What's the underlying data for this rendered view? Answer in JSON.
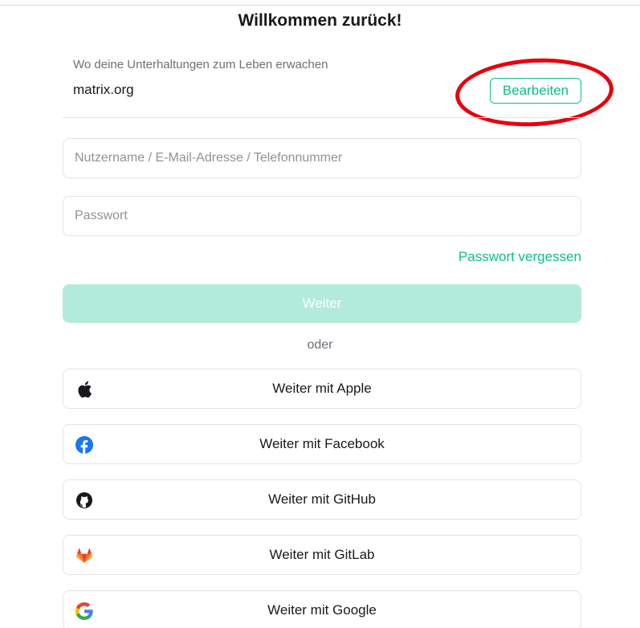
{
  "header": {
    "title": "Willkommen zurück!"
  },
  "server": {
    "tagline": "Wo deine Unterhaltungen zum Leben erwachen",
    "name": "matrix.org",
    "edit_label": "Bearbeiten"
  },
  "form": {
    "username_placeholder": "Nutzername / E-Mail-Adresse / Telefonnummer",
    "password_placeholder": "Passwort",
    "forgot_label": "Passwort vergessen",
    "continue_label": "Weiter"
  },
  "separator": "oder",
  "sso": [
    {
      "label": "Weiter mit Apple",
      "icon": "apple-icon"
    },
    {
      "label": "Weiter mit Facebook",
      "icon": "facebook-icon"
    },
    {
      "label": "Weiter mit GitHub",
      "icon": "github-icon"
    },
    {
      "label": "Weiter mit GitLab",
      "icon": "gitlab-icon"
    },
    {
      "label": "Weiter mit Google",
      "icon": "google-icon"
    }
  ],
  "colors": {
    "accent": "#0dbd8b",
    "accent_disabled": "#b3ebdb",
    "annotation": "#e8000b"
  }
}
